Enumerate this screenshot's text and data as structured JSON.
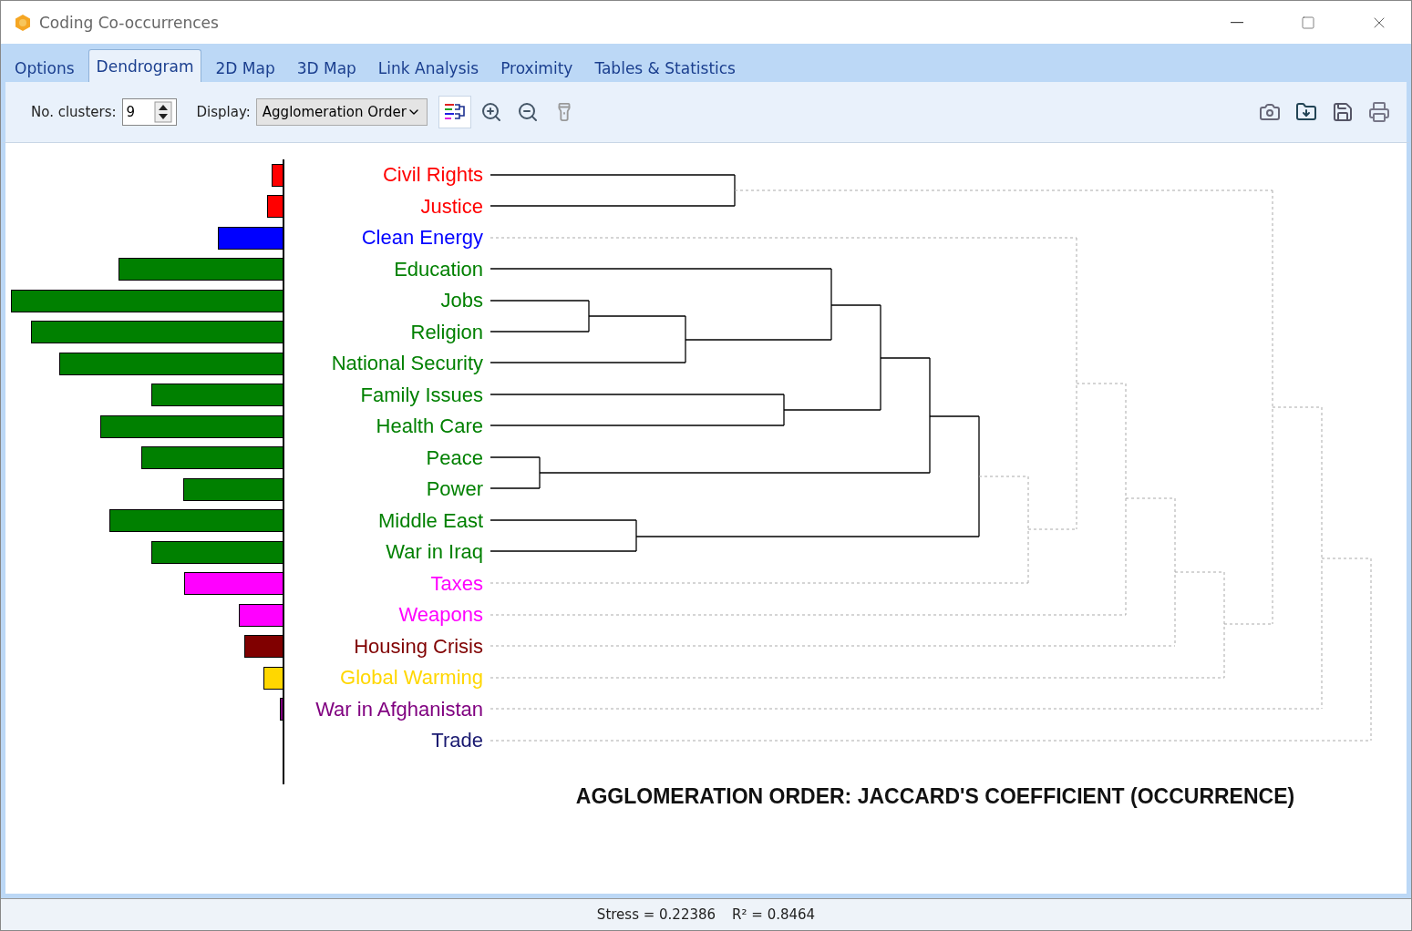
{
  "window": {
    "title": "Coding Co-occurrences"
  },
  "tabs": [
    {
      "label": "Options",
      "selected": false
    },
    {
      "label": "Dendrogram",
      "selected": true
    },
    {
      "label": "2D Map",
      "selected": false
    },
    {
      "label": "3D Map",
      "selected": false
    },
    {
      "label": "Link Analysis",
      "selected": false
    },
    {
      "label": "Proximity",
      "selected": false
    },
    {
      "label": "Tables & Statistics",
      "selected": false
    }
  ],
  "toolbar": {
    "clusters_label": "No. clusters:",
    "clusters_value": "9",
    "display_label": "Display:",
    "display_value": "Agglomeration Order"
  },
  "dendrogram": {
    "items": [
      {
        "label": "Civil Rights",
        "color": "#ff0000",
        "level": 0.04
      },
      {
        "label": "Justice",
        "color": "#ff0000",
        "level": 0.057
      },
      {
        "label": "Clean Energy",
        "color": "#0000ff",
        "level": 0.237
      },
      {
        "label": "Education",
        "color": "#008000",
        "level": 0.603
      },
      {
        "label": "Jobs",
        "color": "#008000",
        "level": 0.997
      },
      {
        "label": "Religion",
        "color": "#008000",
        "level": 0.923
      },
      {
        "label": "National Security",
        "color": "#008000",
        "level": 0.82
      },
      {
        "label": "Family Issues",
        "color": "#008000",
        "level": 0.48
      },
      {
        "label": "Health Care",
        "color": "#008000",
        "level": 0.67
      },
      {
        "label": "Peace",
        "color": "#008000",
        "level": 0.52
      },
      {
        "label": "Power",
        "color": "#008000",
        "level": 0.363
      },
      {
        "label": "Middle East",
        "color": "#008000",
        "level": 0.637
      },
      {
        "label": "War in Iraq",
        "color": "#008000",
        "level": 0.48
      },
      {
        "label": "Taxes",
        "color": "#ff00ff",
        "level": 0.36
      },
      {
        "label": "Weapons",
        "color": "#ff00ff",
        "level": 0.16
      },
      {
        "label": "Housing Crisis",
        "color": "#800000",
        "level": 0.14
      },
      {
        "label": "Global Warming",
        "color": "#ffd700",
        "level": 0.07
      },
      {
        "label": "War in Afghanistan",
        "color": "#800080",
        "level": 0.01
      },
      {
        "label": "Trade",
        "color": "#191970"
      }
    ],
    "title": "AGGLOMERATION ORDER: JACCARD'S COEFFICIENT (OCCURRENCE)"
  },
  "status_bar": {
    "stress": "Stress = 0.22386",
    "r2": "R² = 0.8464"
  }
}
